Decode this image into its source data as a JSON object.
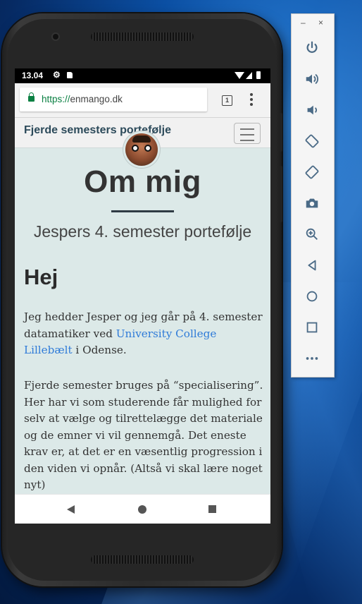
{
  "status_bar": {
    "time": "13.04"
  },
  "browser": {
    "url_scheme": "https://",
    "url_host": "enmango.dk",
    "tab_count": "1"
  },
  "site": {
    "brand": "Fjerde semesters portefølje",
    "heading": "Om mig",
    "subtitle": "Jespers 4. semester portefølje",
    "section_heading": "Hej",
    "p1_before": "Jeg hedder Jesper og jeg går på 4. semester datamatiker ved ",
    "p1_link": "University College Lillebælt",
    "p1_after": " i Odense.",
    "p2": "Fjerde semester bruges på “specialisering”. Her har vi som studerende får mulighed for selv at vælge og tilrettelægge det materiale og de emner vi vil gennemgå. Det eneste krav er, at det er en væsentlig progression i den viden vi opnår. (Altså vi skal lære noget nyt)"
  },
  "emulator_panel": {
    "minimize": "–",
    "close": "×",
    "buttons": [
      "power",
      "volume-up",
      "volume-down",
      "rotate-left",
      "rotate-right",
      "screenshot",
      "zoom",
      "back",
      "home",
      "overview",
      "more"
    ]
  },
  "colors": {
    "link": "#2f7bd8",
    "page_bg": "#dce9e8",
    "brand": "#2c4a5a",
    "lock": "#0b8043",
    "panel_icon": "#4a6a86"
  }
}
